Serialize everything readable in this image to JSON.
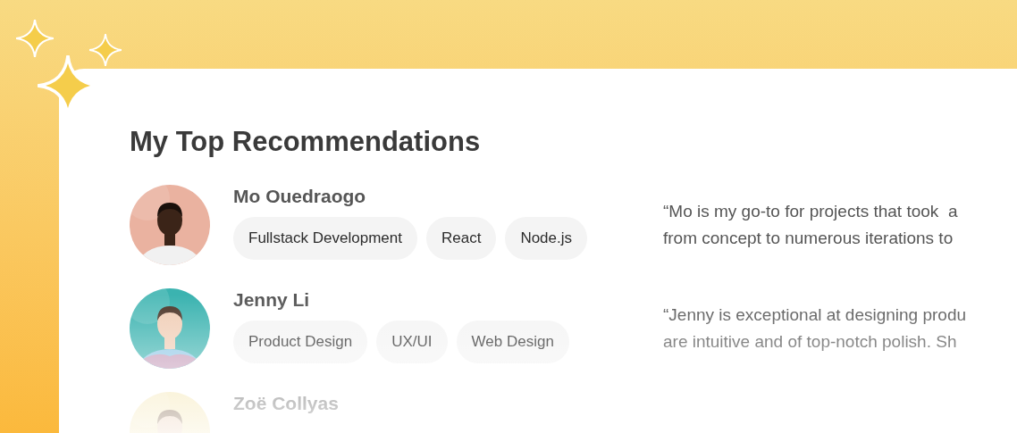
{
  "title": "My Top Recommendations",
  "people": [
    {
      "name": "Mo Ouedraogo",
      "skills": [
        "Fullstack Development",
        "React",
        "Node.js"
      ],
      "quote_lines": [
        "“Mo is my go-to for projects that took  a",
        "from concept to numerous iterations to"
      ],
      "avatar": {
        "kind": "picture"
      }
    },
    {
      "name": "Jenny Li",
      "skills": [
        "Product Design",
        "UX/UI",
        "Web Design"
      ],
      "quote_lines": [
        "“Jenny is exceptional at designing produ",
        "are intuitive and of top-notch polish. Sh"
      ],
      "avatar": {
        "kind": "picture"
      }
    },
    {
      "name": "Zoë Collyas",
      "avatar": {
        "kind": "picture"
      }
    }
  ]
}
